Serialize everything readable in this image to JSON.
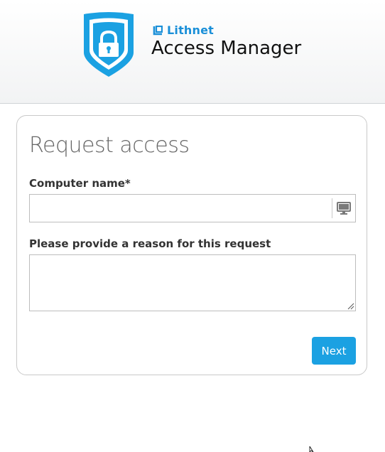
{
  "header": {
    "brand": "Lithnet",
    "product": "Access Manager",
    "brand_color": "#1a8fd8",
    "logo_icon": "shield-lock-icon"
  },
  "form": {
    "title": "Request access",
    "computer_label": "Computer name*",
    "computer_value": "",
    "computer_addon_icon": "monitor-icon",
    "reason_label": "Please provide a reason for this request",
    "reason_value": "",
    "next_label": "Next",
    "accent_color": "#1ba1e2"
  }
}
